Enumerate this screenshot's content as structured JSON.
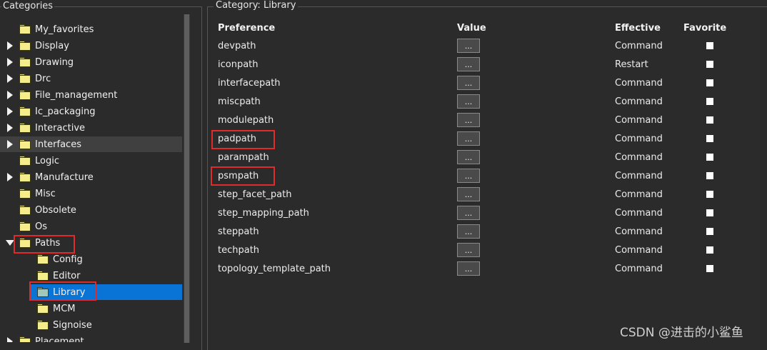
{
  "categories": {
    "title": "Categories",
    "items": [
      {
        "label": "My_favorites",
        "arrow": "none"
      },
      {
        "label": "Display",
        "arrow": "right"
      },
      {
        "label": "Drawing",
        "arrow": "right"
      },
      {
        "label": "Drc",
        "arrow": "right"
      },
      {
        "label": "File_management",
        "arrow": "right"
      },
      {
        "label": "Ic_packaging",
        "arrow": "right"
      },
      {
        "label": "Interactive",
        "arrow": "right"
      },
      {
        "label": "Interfaces",
        "arrow": "right"
      },
      {
        "label": "Logic",
        "arrow": "none"
      },
      {
        "label": "Manufacture",
        "arrow": "right"
      },
      {
        "label": "Misc",
        "arrow": "none"
      },
      {
        "label": "Obsolete",
        "arrow": "none"
      },
      {
        "label": "Os",
        "arrow": "none"
      },
      {
        "label": "Paths",
        "arrow": "down"
      },
      {
        "label": "Config",
        "arrow": "none"
      },
      {
        "label": "Editor",
        "arrow": "none"
      },
      {
        "label": "Library",
        "arrow": "none"
      },
      {
        "label": "MCM",
        "arrow": "none"
      },
      {
        "label": "Signoise",
        "arrow": "none"
      },
      {
        "label": "Placement",
        "arrow": "right"
      }
    ]
  },
  "panel": {
    "title": "Category:  Library",
    "headers": {
      "preference": "Preference",
      "value": "Value",
      "effective": "Effective",
      "favorite": "Favorite"
    },
    "value_button_label": "...",
    "rows": [
      {
        "name": "devpath",
        "effective": "Command"
      },
      {
        "name": "iconpath",
        "effective": "Restart"
      },
      {
        "name": "interfacepath",
        "effective": "Command"
      },
      {
        "name": "miscpath",
        "effective": "Command"
      },
      {
        "name": "modulepath",
        "effective": "Command"
      },
      {
        "name": "padpath",
        "effective": "Command"
      },
      {
        "name": "parampath",
        "effective": "Command"
      },
      {
        "name": "psmpath",
        "effective": "Command"
      },
      {
        "name": "step_facet_path",
        "effective": "Command"
      },
      {
        "name": "step_mapping_path",
        "effective": "Command"
      },
      {
        "name": "steppath",
        "effective": "Command"
      },
      {
        "name": "techpath",
        "effective": "Command"
      },
      {
        "name": "topology_template_path",
        "effective": "Command"
      }
    ]
  },
  "watermark": "CSDN @进击的小鲨鱼",
  "colors": {
    "selection": "#0a74d6",
    "highlight_box": "#e02b2b",
    "background": "#2b2b2b"
  }
}
